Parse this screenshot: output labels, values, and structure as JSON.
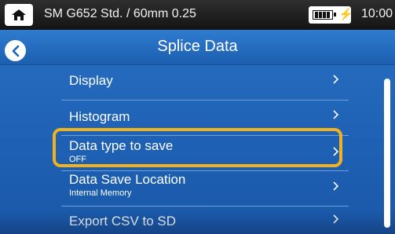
{
  "statusbar": {
    "home_icon": "home-icon",
    "profile": "SM G652 Std. / 60mm 0.25",
    "battery_icon": "battery-charging-icon",
    "time": "10:00"
  },
  "titlebar": {
    "back_icon": "chevron-left-icon",
    "title": "Splice Data"
  },
  "menu": {
    "items": [
      {
        "label": "Display",
        "sub": ""
      },
      {
        "label": "Histogram",
        "sub": ""
      },
      {
        "label": "Data type to save",
        "sub": "OFF"
      },
      {
        "label": "Data Save Location",
        "sub": "Internal Memory"
      },
      {
        "label": "Export CSV to SD",
        "sub": ""
      }
    ],
    "chevron_icon": "chevron-right-icon"
  },
  "colors": {
    "background": "#1f62b6",
    "highlight": "#f2b21c",
    "statusbar": "#1e1e1e"
  }
}
